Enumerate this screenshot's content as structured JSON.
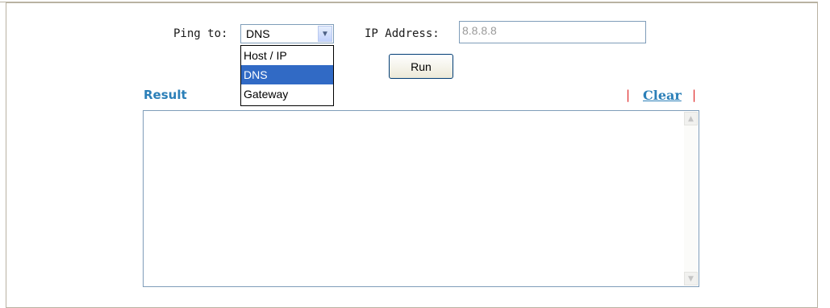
{
  "ping": {
    "label": "Ping to:",
    "selected": "DNS",
    "options": [
      "Host / IP",
      "DNS",
      "Gateway"
    ],
    "highlighted_option": "DNS"
  },
  "ip": {
    "label": "IP Address:",
    "value": "8.8.8.8"
  },
  "run": {
    "label": "Run"
  },
  "result": {
    "title": "Result",
    "clear_label": "Clear",
    "separator": "|",
    "content": ""
  },
  "icons": {
    "dropdown": "chevron-down-icon",
    "scroll_up": "scroll-up-arrow-icon",
    "scroll_down": "scroll-down-arrow-icon"
  }
}
